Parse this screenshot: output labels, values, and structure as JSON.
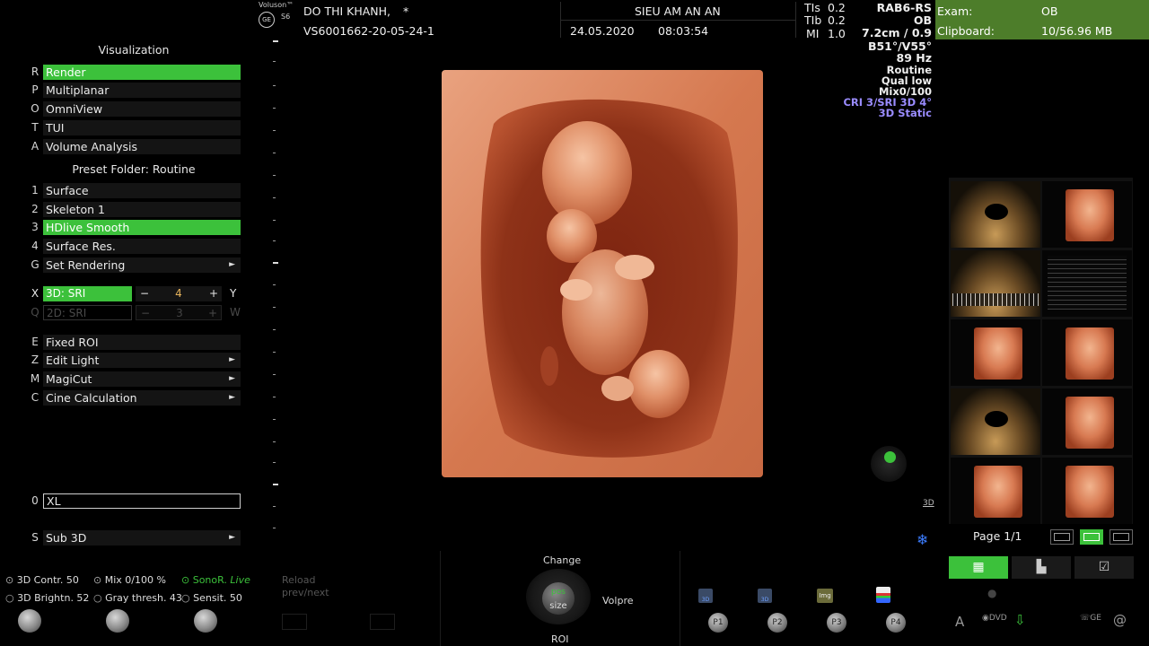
{
  "header": {
    "brand": "Voluson™",
    "model": "S6",
    "logo": "GE",
    "patient_name": "DO THI KHANH,",
    "patient_mark": "*",
    "patient_id": "VS6001662-20-05-24-1",
    "clinic": "SIEU AM AN AN",
    "date": "24.05.2020",
    "time": "08:03:54",
    "tis_label": "TIs",
    "tis": "0.2",
    "tib_label": "TIb",
    "tib": "0.2",
    "mi_label": "MI",
    "mi": "1.0"
  },
  "params": {
    "probe": "RAB6-RS",
    "preset": "OB",
    "depth": "7.2cm / 0.9",
    "angles": "B51°/V55°",
    "freq": "89 Hz",
    "mode": "Routine",
    "qual": "Qual low",
    "mix": "Mix0/100",
    "cri": "CRI 3/SRI 3D 4°",
    "static": "3D Static"
  },
  "exam": {
    "exam_label": "Exam:",
    "exam_value": "OB",
    "clip_label": "Clipboard:",
    "clip_value": "10/56.96 MB"
  },
  "visualization": {
    "title": "Visualization",
    "items": [
      {
        "key": "R",
        "label": "Render"
      },
      {
        "key": "P",
        "label": "Multiplanar"
      },
      {
        "key": "O",
        "label": "OmniView"
      },
      {
        "key": "T",
        "label": "TUI"
      },
      {
        "key": "A",
        "label": "Volume Analysis"
      }
    ]
  },
  "preset_folder": {
    "title": "Preset Folder: Routine",
    "items": [
      {
        "key": "1",
        "label": "Surface"
      },
      {
        "key": "2",
        "label": "Skeleton 1"
      },
      {
        "key": "3",
        "label": "HDlive Smooth"
      },
      {
        "key": "4",
        "label": "Surface Res."
      },
      {
        "key": "G",
        "label": "Set Rendering",
        "arrow": "►"
      }
    ]
  },
  "sri": {
    "row1": {
      "key": "X",
      "label": "3D: SRI",
      "minus": "−",
      "value": "4",
      "plus": "+",
      "key2": "Y"
    },
    "row2": {
      "key": "Q",
      "label": "2D: SRI",
      "minus": "−",
      "value": "3",
      "plus": "+",
      "key2": "W"
    }
  },
  "tools": {
    "items": [
      {
        "key": "E",
        "label": "Fixed ROI"
      },
      {
        "key": "Z",
        "label": "Edit Light",
        "arrow": "►"
      },
      {
        "key": "M",
        "label": "MagiCut",
        "arrow": "►"
      },
      {
        "key": "C",
        "label": "Cine Calculation",
        "arrow": "►"
      }
    ]
  },
  "xl": {
    "key": "0",
    "label": "XL"
  },
  "sub3d": {
    "key": "S",
    "label": "Sub 3D",
    "arrow": "►"
  },
  "bottom": {
    "contr": "3D Contr. 50",
    "mix": "Mix 0/100 %",
    "sonor": "SonoR.",
    "sonor_live": "Live",
    "brightn": "3D Brightn. 52",
    "gray": "Gray thresh. 43",
    "sensit": "Sensit. 50",
    "reload": "Reload",
    "prevnext": "prev/next",
    "change": "Change",
    "pos": "pos",
    "size": "size",
    "roi": "ROI",
    "volpre": "Volpre",
    "p1": "P1",
    "p2": "P2",
    "p3": "P3",
    "p4": "P4",
    "img": "Img",
    "tag3d": "3D",
    "page": "Page 1/1",
    "dvd": "DVD",
    "ge": "GE"
  },
  "colors": {
    "accent_green": "#3cc13b",
    "exam_green": "#4d7d2a",
    "lavender": "#9a8cff",
    "render_orange": "#c8653d"
  }
}
